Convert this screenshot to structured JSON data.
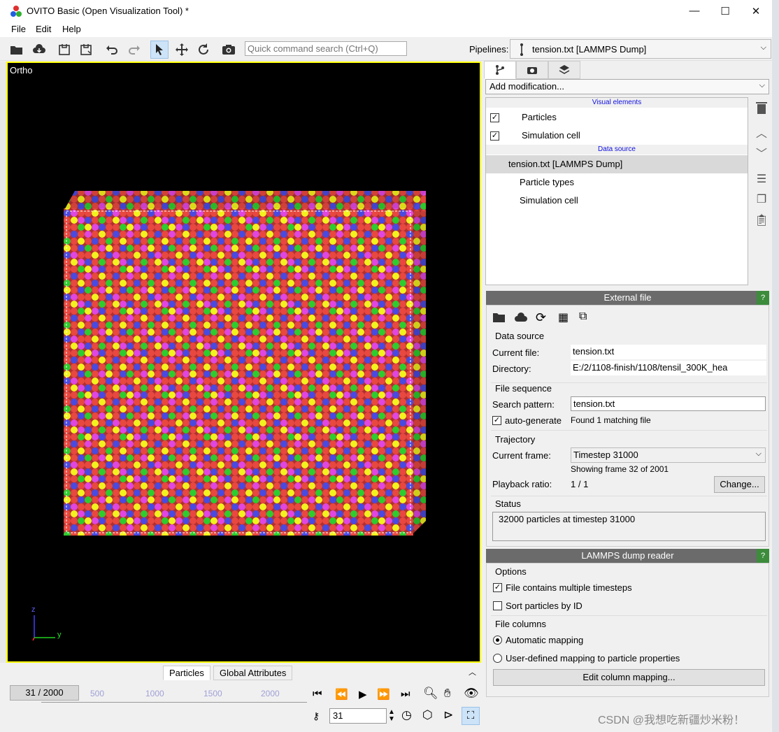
{
  "window": {
    "title": "OVITO Basic (Open Visualization Tool) *",
    "minimize": "—",
    "maximize": "☐",
    "close": "✕"
  },
  "menu": [
    "File",
    "Edit",
    "Help"
  ],
  "toolbar": {
    "search_placeholder": "Quick command search (Ctrl+Q)",
    "pipelines_label": "Pipelines:",
    "pipeline_selected": "tension.txt [LAMMPS Dump]"
  },
  "viewport": {
    "caption": "Ortho",
    "axis_z": "z",
    "axis_y": "y"
  },
  "bottom_tabs": [
    "Particles",
    "Global Attributes"
  ],
  "timeline": {
    "frame_display": "31 / 2000",
    "ticks": [
      "500",
      "1000",
      "1500",
      "2000"
    ],
    "spinner_value": "31"
  },
  "pipeline_editor": {
    "add_modification": "Add modification...",
    "visual_elements_header": "Visual elements",
    "visual_elements": [
      {
        "label": "Particles",
        "checked": true
      },
      {
        "label": "Simulation cell",
        "checked": true
      }
    ],
    "data_source_header": "Data source",
    "data_source": "tension.txt [LAMMPS Dump]",
    "data_source_children": [
      "Particle types",
      "Simulation cell"
    ]
  },
  "external_file": {
    "header": "External file",
    "help": "?",
    "data_source_title": "Data source",
    "current_file_label": "Current file:",
    "current_file": "tension.txt",
    "directory_label": "Directory:",
    "directory": "E:/2/1108-finish/1108/tensil_300K_hea",
    "file_sequence_title": "File sequence",
    "search_pattern_label": "Search pattern:",
    "search_pattern": "tension.txt",
    "auto_generate_label": "auto-generate",
    "auto_generate_checked": true,
    "matching_text": "Found 1 matching file",
    "trajectory_title": "Trajectory",
    "current_frame_label": "Current frame:",
    "current_frame": "Timestep 31000",
    "showing_frame": "Showing frame 32 of 2001",
    "playback_ratio_label": "Playback ratio:",
    "playback_ratio": "1 / 1",
    "change_button": "Change...",
    "status_title": "Status",
    "status_text": "32000 particles at timestep 31000"
  },
  "lammps_reader": {
    "header": "LAMMPS dump reader",
    "help": "?",
    "options_title": "Options",
    "multiple_timesteps_label": "File contains multiple timesteps",
    "multiple_timesteps_checked": true,
    "sort_label": "Sort particles by ID",
    "sort_checked": false,
    "file_columns_title": "File columns",
    "auto_mapping_label": "Automatic mapping",
    "user_mapping_label": "User-defined mapping to particle properties",
    "edit_mapping_button": "Edit column mapping..."
  },
  "watermark": "CSDN @我想吃新疆炒米粉！",
  "colors": {
    "particle_red": "#e8483f",
    "particle_yellow": "#f2f21e",
    "particle_blue": "#4a4ae0",
    "particle_green": "#2ecc2e",
    "particle_magenta": "#e046e0",
    "panel_header": "#6b6b6b",
    "help_green": "#3c8c3c",
    "viewport_border": "#ffff00"
  }
}
